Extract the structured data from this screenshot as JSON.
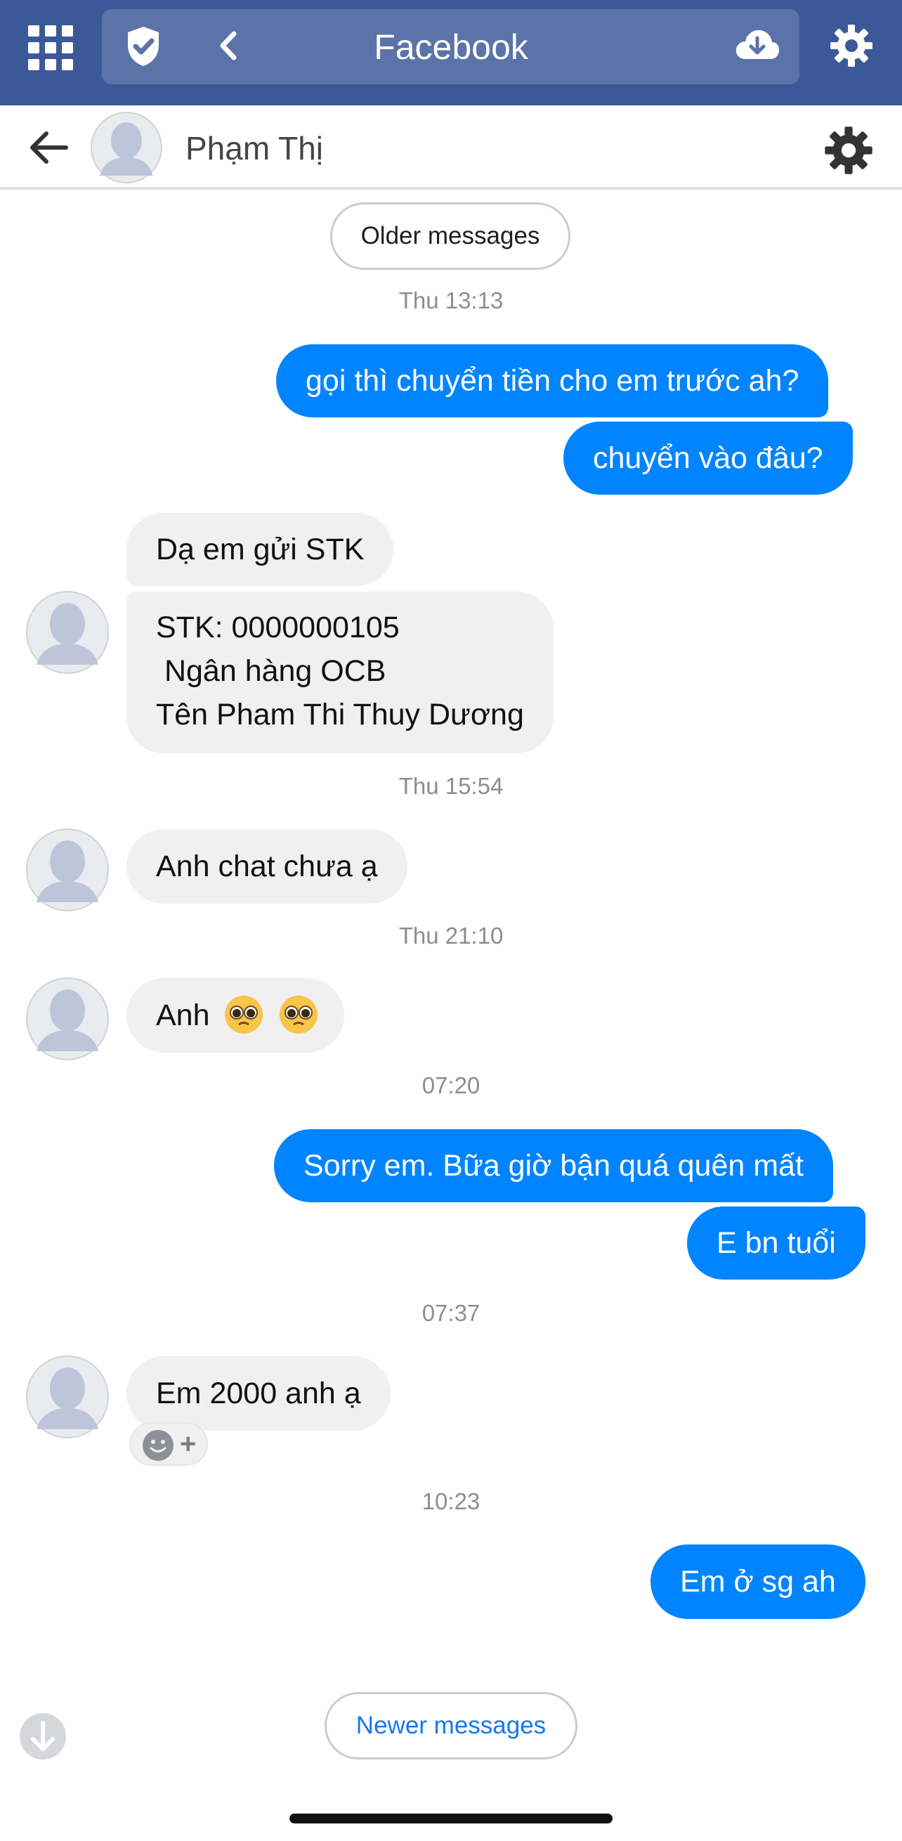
{
  "app_bar": {
    "title": "Facebook",
    "grid_icon": "grid-menu-icon",
    "shield_icon": "shield-check-icon",
    "back_icon": "chevron-left-icon",
    "download_icon": "cloud-download-icon",
    "settings_icon": "gear-icon",
    "color": "#3b5998"
  },
  "chat_header": {
    "contact_name": "Phạm Thị",
    "back_icon": "arrow-left-icon",
    "settings_icon": "gear-icon"
  },
  "older_messages_label": "Older messages",
  "newer_messages_label": "Newer messages",
  "timestamps": {
    "t1": "Thu 13:13",
    "t2": "Thu 15:54",
    "t3": "Thu 21:10",
    "t4": "07:20",
    "t5": "07:37",
    "t6": "10:23"
  },
  "messages": {
    "m1": "gọi thì chuyển tiền cho em trước ah?",
    "m2": "chuyển vào đâu?",
    "m3": "Dạ em gửi STK",
    "m4_line1": "STK: 0000000105",
    "m4_line2": " Ngân hàng OCB",
    "m4_line3": "Tên Pham Thi Thuy Dương",
    "m5": "Anh chat chưa ạ",
    "m6": "Anh",
    "m7": "Sorry em. Bữa giờ bận quá quên mất",
    "m8": "E bn tuổi",
    "m9": "Em 2000 anh ạ",
    "m10": "Em ở sg ah"
  },
  "reaction_chip": {
    "icon": "smiley-icon",
    "plus": "+"
  },
  "colors": {
    "outgoing": "#0084ff",
    "incoming": "#f0f0f0",
    "link": "#1877f2"
  }
}
